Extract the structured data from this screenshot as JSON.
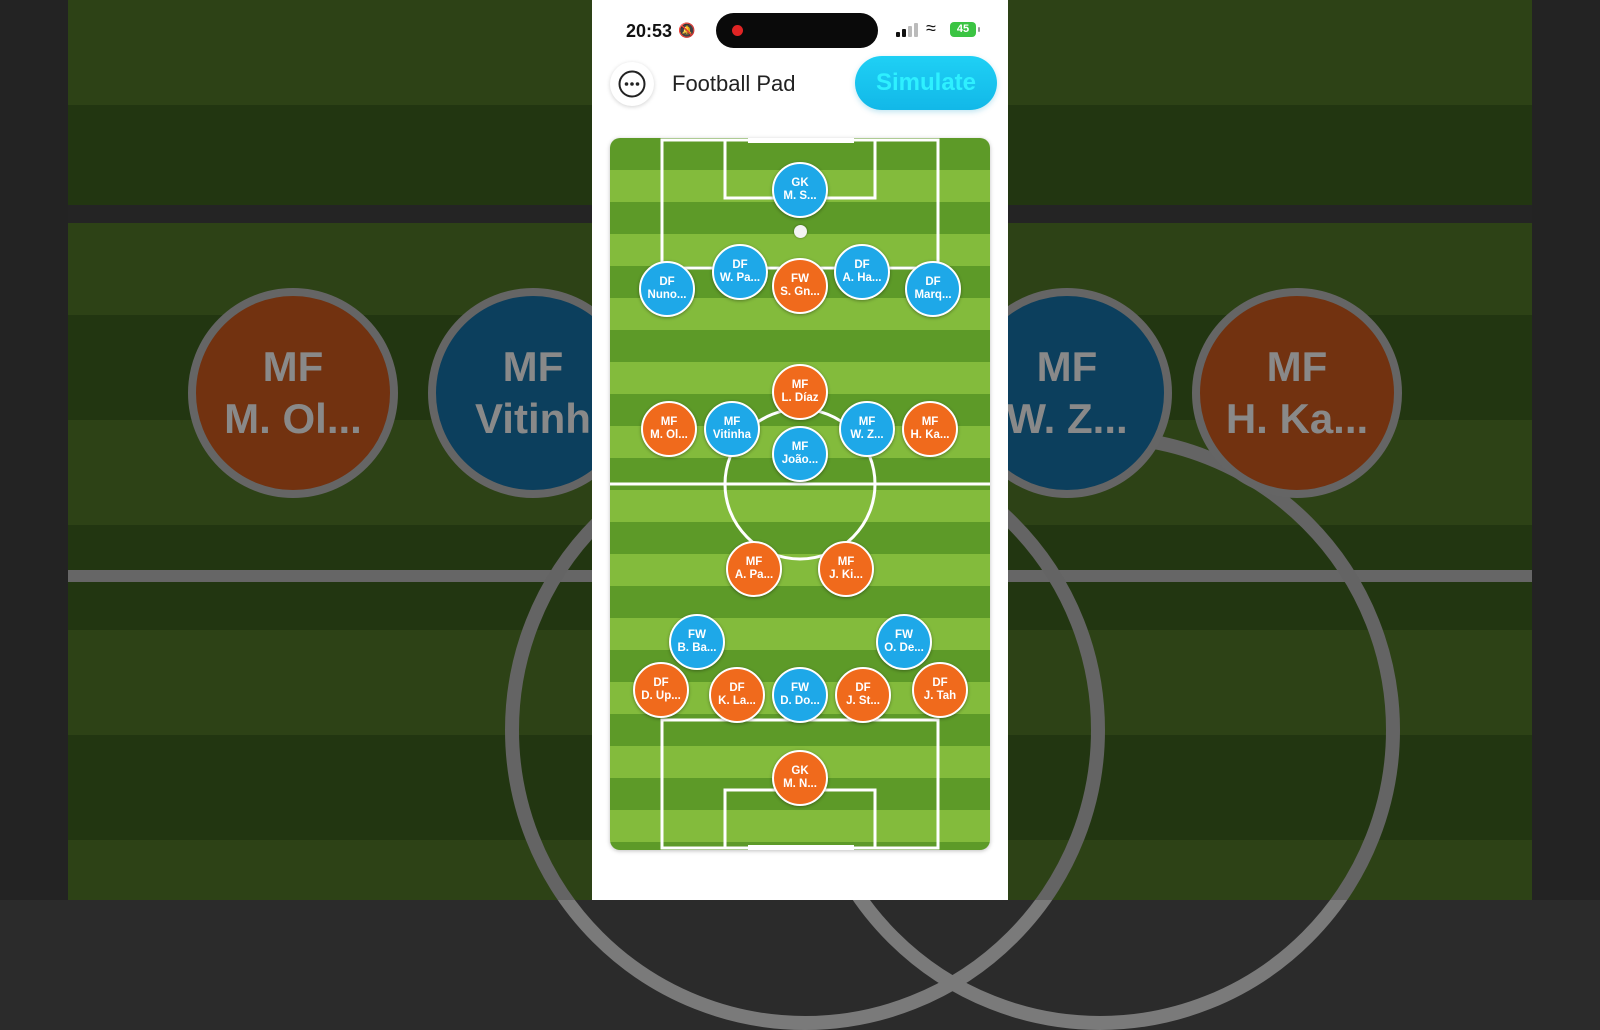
{
  "status_bar": {
    "time": "20:53",
    "battery": "45"
  },
  "header": {
    "title": "Football Pad",
    "simulate_label": "Simulate"
  },
  "colors": {
    "team_orange": "#f06a1c",
    "team_blue": "#1ea8e8",
    "simulate": "#1fd0f5"
  },
  "background_players": [
    {
      "pos": "MF",
      "name": "M. Ol...",
      "team": "orange"
    },
    {
      "pos": "MF",
      "name": "Vitinh",
      "team": "blue"
    },
    {
      "pos": "MF",
      "name": "W. Z...",
      "team": "blue"
    },
    {
      "pos": "MF",
      "name": "H. Ka...",
      "team": "orange"
    }
  ],
  "players": [
    {
      "pos": "GK",
      "name": "M. S...",
      "team": "blue"
    },
    {
      "pos": "DF",
      "name": "W. Pa...",
      "team": "blue"
    },
    {
      "pos": "FW",
      "name": "S. Gn...",
      "team": "orange"
    },
    {
      "pos": "DF",
      "name": "A. Ha...",
      "team": "blue"
    },
    {
      "pos": "DF",
      "name": "Nuno...",
      "team": "blue"
    },
    {
      "pos": "DF",
      "name": "Marq...",
      "team": "blue"
    },
    {
      "pos": "MF",
      "name": "L. Díaz",
      "team": "orange"
    },
    {
      "pos": "MF",
      "name": "M. Ol...",
      "team": "orange"
    },
    {
      "pos": "MF",
      "name": "Vitinha",
      "team": "blue"
    },
    {
      "pos": "MF",
      "name": "W. Z...",
      "team": "blue"
    },
    {
      "pos": "MF",
      "name": "H. Ka...",
      "team": "orange"
    },
    {
      "pos": "MF",
      "name": "João...",
      "team": "blue"
    },
    {
      "pos": "MF",
      "name": "A. Pa...",
      "team": "orange"
    },
    {
      "pos": "MF",
      "name": "J. Ki...",
      "team": "orange"
    },
    {
      "pos": "FW",
      "name": "B. Ba...",
      "team": "blue"
    },
    {
      "pos": "FW",
      "name": "O. De...",
      "team": "blue"
    },
    {
      "pos": "DF",
      "name": "D. Up...",
      "team": "orange"
    },
    {
      "pos": "DF",
      "name": "K. La...",
      "team": "orange"
    },
    {
      "pos": "FW",
      "name": "D. Do...",
      "team": "blue"
    },
    {
      "pos": "DF",
      "name": "J. St...",
      "team": "orange"
    },
    {
      "pos": "DF",
      "name": "J. Tah",
      "team": "orange"
    },
    {
      "pos": "GK",
      "name": "M. N...",
      "team": "orange"
    }
  ]
}
